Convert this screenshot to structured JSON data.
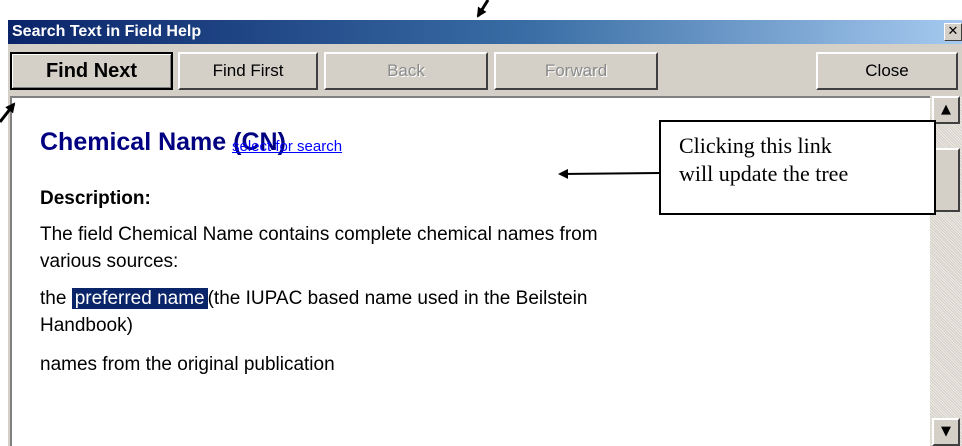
{
  "window": {
    "title": "Search Text in Field Help",
    "close_glyph": "✕"
  },
  "toolbar": {
    "find_next": "Find Next",
    "find_first": "Find First",
    "back": "Back",
    "forward": "Forward",
    "close": "Close"
  },
  "content": {
    "heading": "Chemical Name (CN)",
    "link": "select for search",
    "description_label": "Description:",
    "para1_line1": "The field Chemical Name contains complete chemical names from",
    "para1_line2": "various sources:",
    "para2_prefix": "the ",
    "para2_highlight": "preferred name",
    "para2_suffix": "(the IUPAC based name used in the Beilstein",
    "para2_line2": "Handbook)",
    "para3": "names from the original publication"
  },
  "callout": {
    "line1": "Clicking this link",
    "line2": "will update the tree"
  },
  "scrollbar": {
    "up_glyph": "▲",
    "down_glyph": "▼"
  },
  "colors": {
    "titlebar_start": "#0a246a",
    "titlebar_end": "#a6caf0",
    "heading": "#000080",
    "link": "#0000ff",
    "highlight": "#0a246a"
  }
}
